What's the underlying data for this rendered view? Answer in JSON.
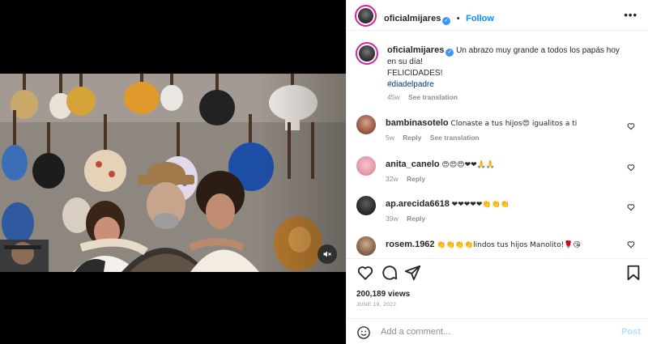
{
  "header": {
    "username": "oficialmijares",
    "separator": "•",
    "follow_label": "Follow",
    "more_label": "•••"
  },
  "caption": {
    "username": "oficialmijares",
    "text": "Un abrazo muy grande a todos los papás hoy en su día!",
    "line2": "FELICIDADES!",
    "hashtag": "#diadelpadre",
    "age": "45w",
    "see_translation": "See translation"
  },
  "comments": [
    {
      "username": "bambinasotelo",
      "text": "Clonaste a tus hijos😍 igualitos a ti",
      "age": "5w",
      "reply": "Reply",
      "see_translation": "See translation"
    },
    {
      "username": "anita_canelo",
      "text": "😍😍😍❤❤🙏🙏",
      "age": "32w",
      "reply": "Reply"
    },
    {
      "username": "ap.arecida6618",
      "text": "❤❤❤❤❤👏👏👏",
      "age": "39w",
      "reply": "Reply"
    },
    {
      "username": "rosem.1962",
      "text": "👏👏👏👏lindos tus hijos Manolito!🌹😘"
    }
  ],
  "stats": {
    "views": "200,189 views",
    "date": "JUNE 19, 2022"
  },
  "add_comment": {
    "placeholder": "Add a comment...",
    "post_label": "Post"
  },
  "colors": {
    "link_blue": "#0095f6",
    "post_disabled": "#b2dffc",
    "muted_text": "#8e8e8e",
    "story_ring": "#d6249f"
  },
  "icons": [
    "verified-badge-icon",
    "more-icon",
    "heart-icon",
    "comment-icon",
    "share-icon",
    "bookmark-icon",
    "emoji-icon",
    "mute-icon"
  ]
}
